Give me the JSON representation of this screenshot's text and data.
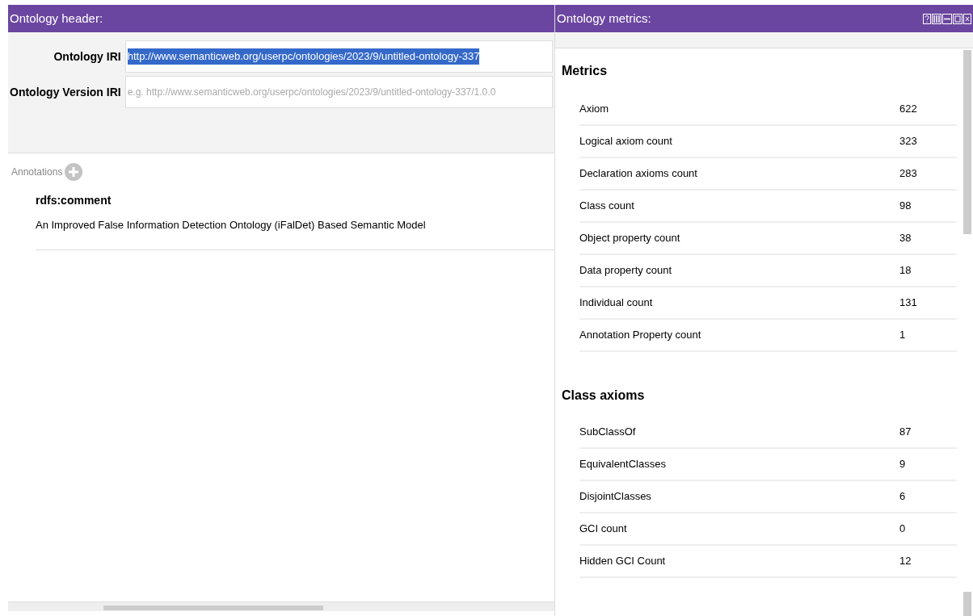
{
  "header_panel": {
    "title": "Ontology header:",
    "fields": [
      {
        "label": "Ontology IRI",
        "value": "http://www.semanticweb.org/userpc/ontologies/2023/9/untitled-ontology-337",
        "text_selected": true
      },
      {
        "label": "Ontology Version IRI",
        "placeholder": "e.g. http://www.semanticweb.org/userpc/ontologies/2023/9/untitled-ontology-337/1.0.0",
        "text_selected": false
      }
    ],
    "annotations_label": "Annotations",
    "annotations": [
      {
        "property": "rdfs:comment",
        "value": "An Improved False Information Detection Ontology (iFalDet) Based Semantic Model"
      }
    ]
  },
  "metrics_panel": {
    "title": "Ontology metrics:",
    "sections": [
      {
        "title": "Metrics",
        "rows": [
          {
            "name": "Axiom",
            "value": "622"
          },
          {
            "name": "Logical axiom count",
            "value": "323"
          },
          {
            "name": "Declaration axioms count",
            "value": "283"
          },
          {
            "name": "Class count",
            "value": "98"
          },
          {
            "name": "Object property count",
            "value": "38"
          },
          {
            "name": "Data property count",
            "value": "18"
          },
          {
            "name": "Individual count",
            "value": "131"
          },
          {
            "name": "Annotation Property count",
            "value": "1"
          }
        ]
      },
      {
        "title": "Class axioms",
        "rows": [
          {
            "name": "SubClassOf",
            "value": "87"
          },
          {
            "name": "EquivalentClasses",
            "value": "9"
          },
          {
            "name": "DisjointClasses",
            "value": "6"
          },
          {
            "name": "GCI count",
            "value": "0"
          },
          {
            "name": "Hidden GCI Count",
            "value": "12"
          }
        ]
      }
    ]
  }
}
